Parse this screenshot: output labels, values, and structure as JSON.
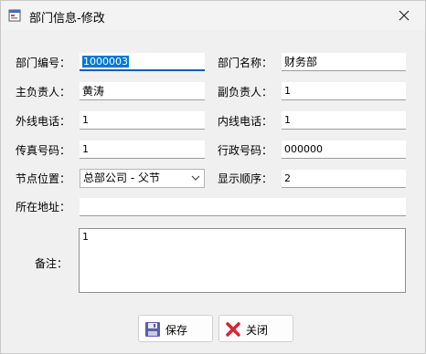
{
  "window": {
    "title": "部门信息-修改"
  },
  "form": {
    "dept_code": {
      "label": "部门编号：",
      "value": "1000003"
    },
    "dept_name": {
      "label": "部门名称：",
      "value": "财务部"
    },
    "manager": {
      "label": "主负责人：",
      "value": "黄涛"
    },
    "deputy": {
      "label": "副负责人：",
      "value": "1"
    },
    "outside_phone": {
      "label": "外线电话：",
      "value": "1"
    },
    "inside_phone": {
      "label": "内线电话：",
      "value": "1"
    },
    "fax": {
      "label": "传真号码：",
      "value": "1"
    },
    "admin_code": {
      "label": "行政号码：",
      "value": "000000"
    },
    "node_position": {
      "label": "节点位置：",
      "value": "总部公司 - 父节"
    },
    "display_order": {
      "label": "显示顺序：",
      "value": "2"
    },
    "address": {
      "label": "所在地址：",
      "value": ""
    },
    "remarks": {
      "label": "备注：",
      "value": "1"
    }
  },
  "buttons": {
    "save": "保存",
    "close": "关闭"
  },
  "colors": {
    "accent": "#005fb8",
    "selection": "#0078d7",
    "close_red": "#d9232d"
  }
}
